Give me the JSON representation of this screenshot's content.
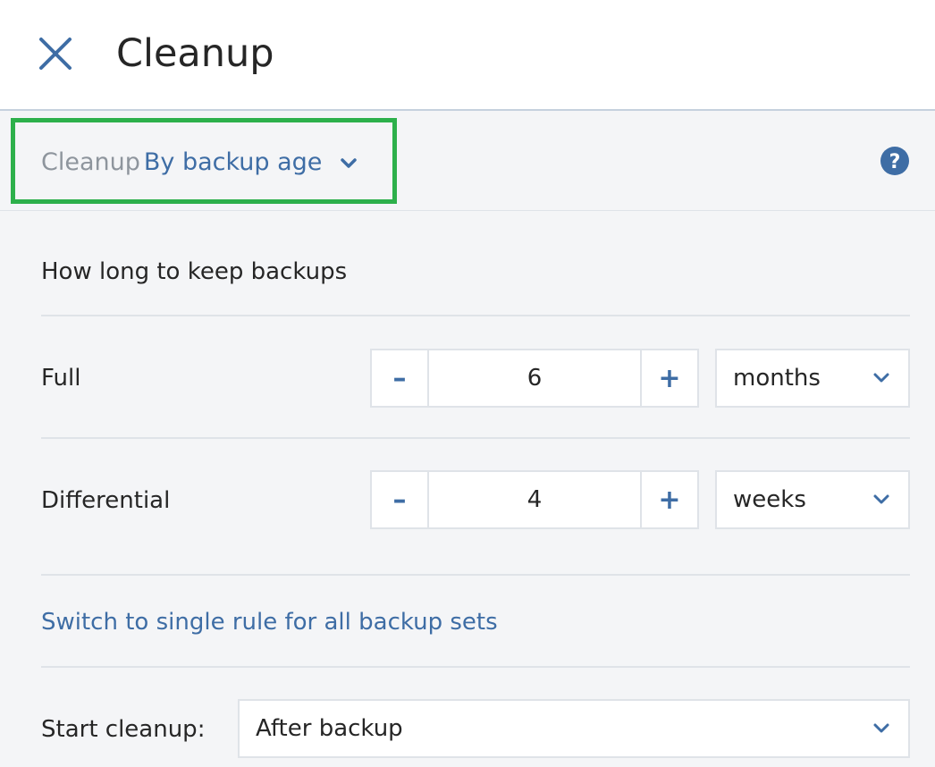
{
  "header": {
    "title": "Cleanup",
    "close_icon": "close-icon"
  },
  "mode": {
    "prefix": "Cleanup",
    "value": "By backup age",
    "help_icon": "help-icon"
  },
  "section": {
    "title": "How long to keep backups"
  },
  "rules": [
    {
      "label": "Full",
      "value": "6",
      "unit": "months",
      "minus": "–",
      "plus": "+"
    },
    {
      "label": "Differential",
      "value": "4",
      "unit": "weeks",
      "minus": "–",
      "plus": "+"
    }
  ],
  "switch_link": "Switch to single rule for all backup sets",
  "start_cleanup": {
    "label": "Start cleanup:",
    "value": "After backup"
  },
  "colors": {
    "accent": "#3e6da5",
    "highlight": "#2db04b",
    "background": "#f4f5f7"
  }
}
